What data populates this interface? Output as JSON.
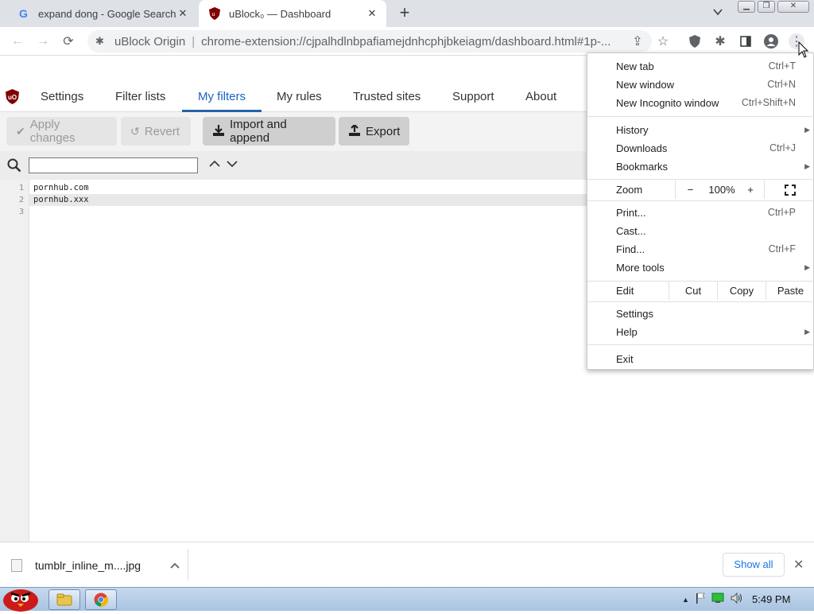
{
  "browser": {
    "tabs": [
      {
        "title": "expand dong - Google Search",
        "favicon": "google-icon",
        "active": false
      },
      {
        "title": "uBlock₀ — Dashboard",
        "favicon": "ublock-icon",
        "active": true
      }
    ],
    "omnibox": {
      "site": "uBlock Origin",
      "url": "chrome-extension://cjpalhdlnbpafiamejdnhcphjbkeiagm/dashboard.html#1p-..."
    }
  },
  "dashboard": {
    "nav": [
      "Settings",
      "Filter lists",
      "My filters",
      "My rules",
      "Trusted sites",
      "Support",
      "About"
    ],
    "active_tab": "My filters",
    "buttons": {
      "apply": "Apply changes",
      "revert": "Revert",
      "import": "Import and append",
      "export": "Export"
    },
    "filter_input": {
      "value": "",
      "placeholder": ""
    },
    "editor_lines": [
      {
        "num": "1",
        "text": "pornhub.com"
      },
      {
        "num": "2",
        "text": "pornhub.xxx"
      },
      {
        "num": "3",
        "text": ""
      }
    ]
  },
  "menu": {
    "new_tab": {
      "label": "New tab",
      "shortcut": "Ctrl+T"
    },
    "new_window": {
      "label": "New window",
      "shortcut": "Ctrl+N"
    },
    "incognito": {
      "label": "New Incognito window",
      "shortcut": "Ctrl+Shift+N"
    },
    "history": {
      "label": "History"
    },
    "downloads": {
      "label": "Downloads",
      "shortcut": "Ctrl+J"
    },
    "bookmarks": {
      "label": "Bookmarks"
    },
    "zoom": {
      "label": "Zoom",
      "minus": "−",
      "value": "100%",
      "plus": "+"
    },
    "print": {
      "label": "Print...",
      "shortcut": "Ctrl+P"
    },
    "cast": {
      "label": "Cast..."
    },
    "find": {
      "label": "Find...",
      "shortcut": "Ctrl+F"
    },
    "more_tools": {
      "label": "More tools"
    },
    "edit": {
      "label": "Edit",
      "cut": "Cut",
      "copy": "Copy",
      "paste": "Paste"
    },
    "settings": {
      "label": "Settings"
    },
    "help": {
      "label": "Help"
    },
    "exit": {
      "label": "Exit"
    }
  },
  "downloads": {
    "item": "tumblr_inline_m....jpg",
    "show_all": "Show all"
  },
  "taskbar": {
    "clock": "5:49 PM"
  }
}
